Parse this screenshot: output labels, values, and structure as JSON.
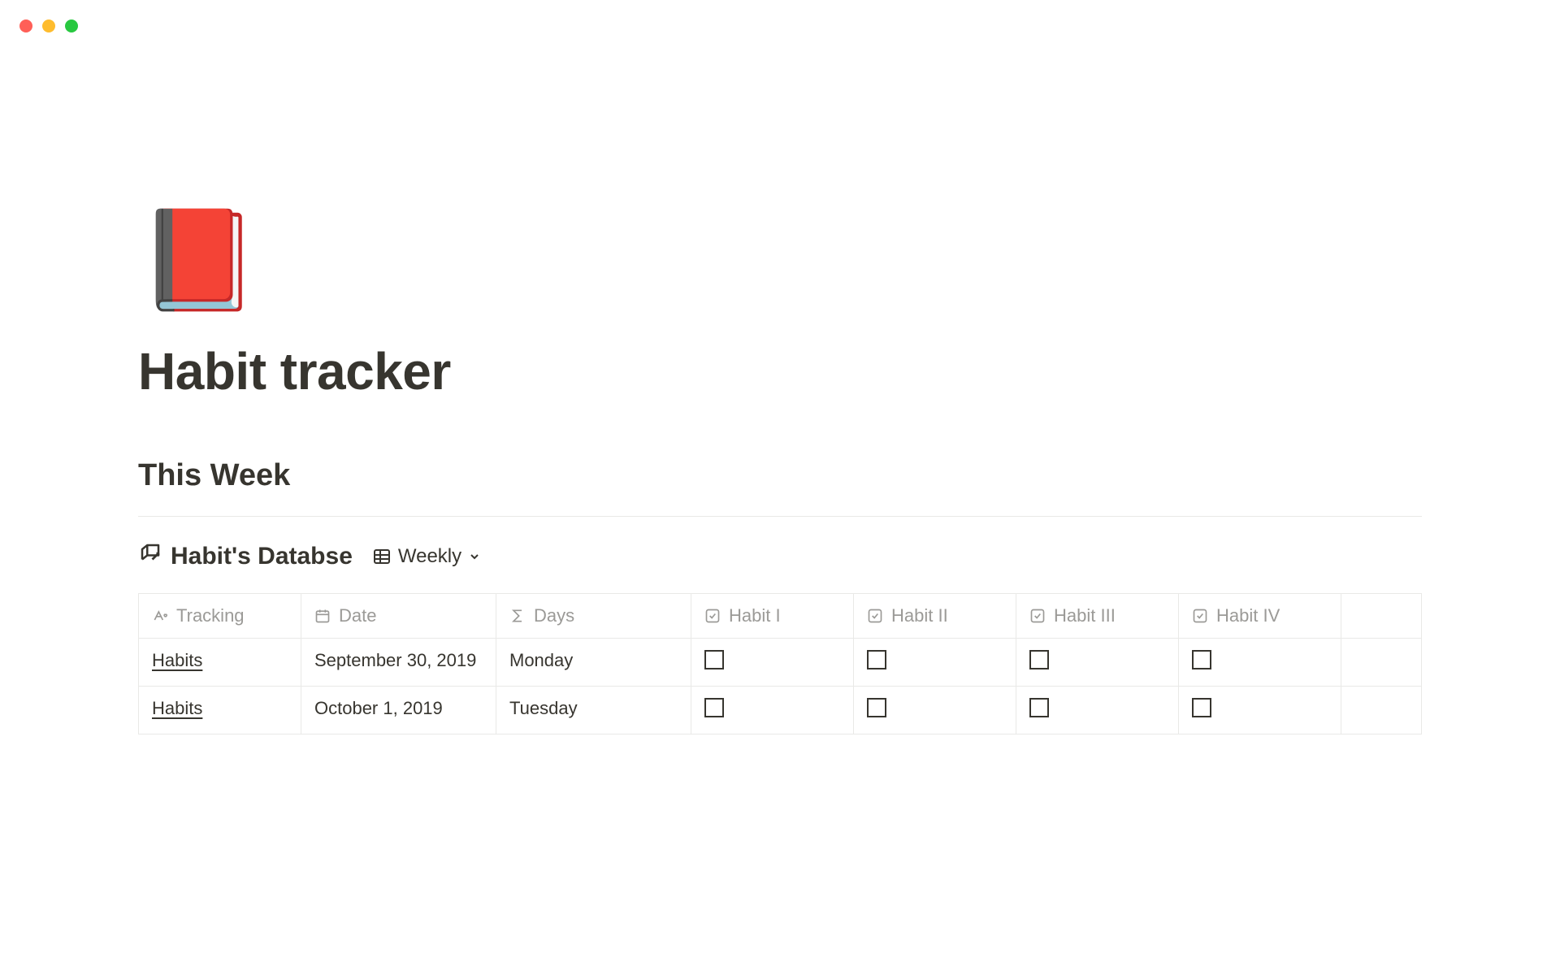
{
  "page": {
    "icon": "📕",
    "title": "Habit tracker"
  },
  "section": {
    "heading": "This Week"
  },
  "database": {
    "icon": "🛌",
    "title": "Habit's Databse",
    "view_label": "Weekly",
    "columns": [
      {
        "label": "Tracking",
        "type": "title"
      },
      {
        "label": "Date",
        "type": "date"
      },
      {
        "label": "Days",
        "type": "formula"
      },
      {
        "label": "Habit I",
        "type": "checkbox"
      },
      {
        "label": "Habit II",
        "type": "checkbox"
      },
      {
        "label": "Habit III",
        "type": "checkbox"
      },
      {
        "label": "Habit IV",
        "type": "checkbox"
      }
    ],
    "rows": [
      {
        "tracking": "Habits",
        "date": "September 30, 2019",
        "days": "Monday",
        "habit1": false,
        "habit2": false,
        "habit3": false,
        "habit4": false
      },
      {
        "tracking": "Habits",
        "date": "October 1, 2019",
        "days": "Tuesday",
        "habit1": false,
        "habit2": false,
        "habit3": false,
        "habit4": false
      }
    ]
  }
}
